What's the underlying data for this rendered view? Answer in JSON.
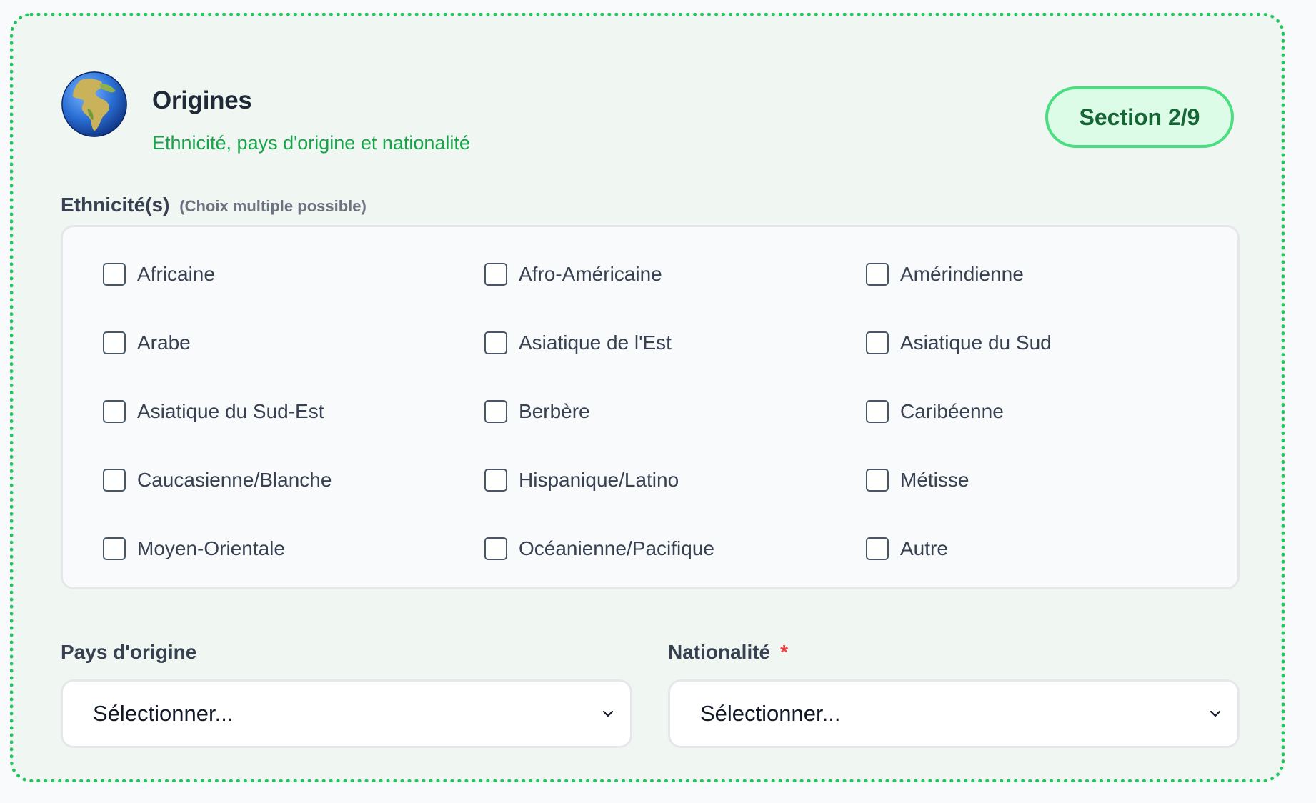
{
  "header": {
    "title": "Origines",
    "subtitle": "Ethnicité, pays d'origine et nationalité",
    "badge": "Section 2/9",
    "icon": "globe-europe-africa-icon"
  },
  "ethnicity": {
    "label": "Ethnicité(s)",
    "hint": "(Choix multiple possible)",
    "options": [
      {
        "label": "Africaine",
        "checked": false
      },
      {
        "label": "Afro-Américaine",
        "checked": false
      },
      {
        "label": "Amérindienne",
        "checked": false
      },
      {
        "label": "Arabe",
        "checked": false
      },
      {
        "label": "Asiatique de l'Est",
        "checked": false
      },
      {
        "label": "Asiatique du Sud",
        "checked": false
      },
      {
        "label": "Asiatique du Sud-Est",
        "checked": false
      },
      {
        "label": "Berbère",
        "checked": false
      },
      {
        "label": "Caribéenne",
        "checked": false
      },
      {
        "label": "Caucasienne/Blanche",
        "checked": false
      },
      {
        "label": "Hispanique/Latino",
        "checked": false
      },
      {
        "label": "Métisse",
        "checked": false
      },
      {
        "label": "Moyen-Orientale",
        "checked": false
      },
      {
        "label": "Océanienne/Pacifique",
        "checked": false
      },
      {
        "label": "Autre",
        "checked": false
      }
    ]
  },
  "country_of_origin": {
    "label": "Pays d'origine",
    "value": "Sélectionner..."
  },
  "nationality": {
    "label": "Nationalité",
    "required_marker": "*",
    "value": "Sélectionner..."
  },
  "colors": {
    "accent": "#22c55e",
    "badge_bg": "#dcfce7",
    "badge_text": "#166534",
    "subtitle": "#16a34a",
    "required": "#ef4444"
  }
}
